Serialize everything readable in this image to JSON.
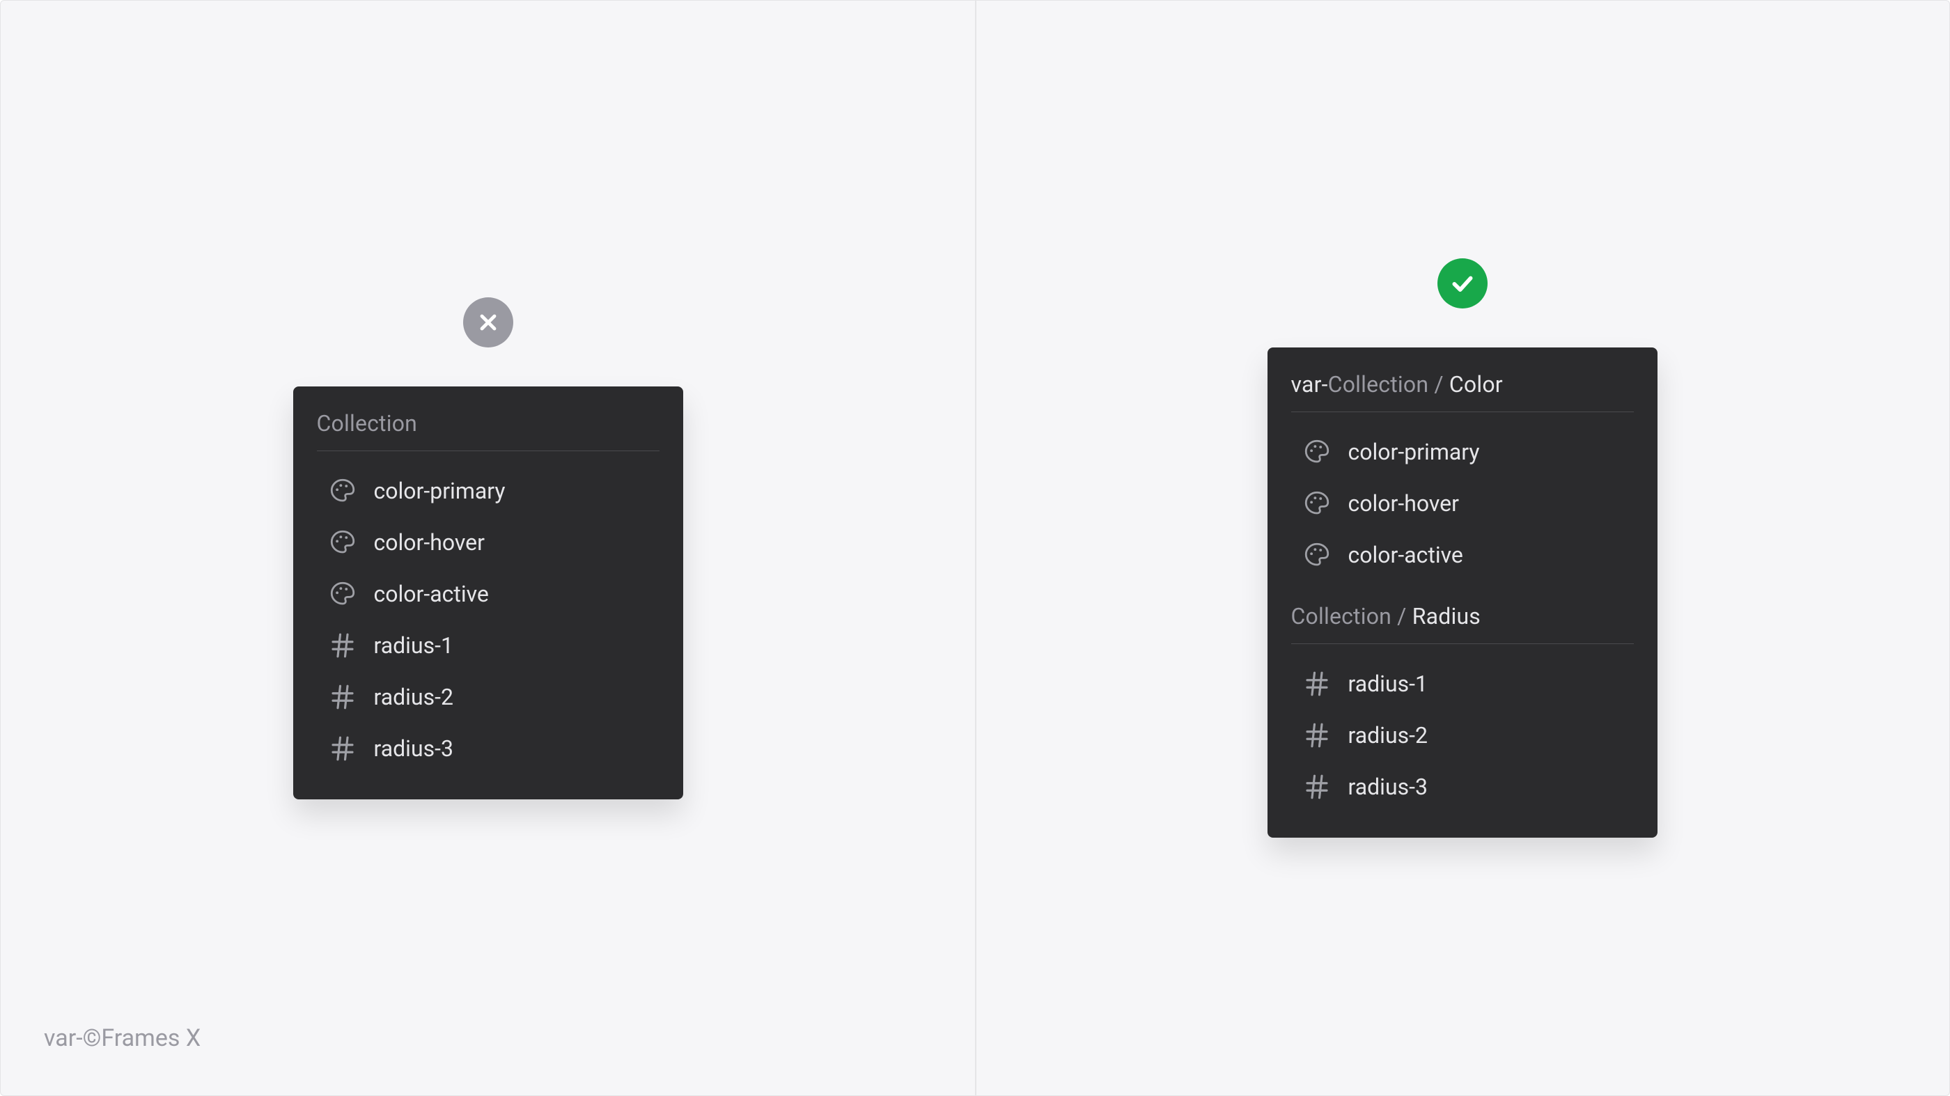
{
  "footer": "var-©Frames X",
  "left": {
    "title": "Collection",
    "items": [
      {
        "icon": "palette",
        "label": "color-primary"
      },
      {
        "icon": "palette",
        "label": "color-hover"
      },
      {
        "icon": "palette",
        "label": "color-active"
      },
      {
        "icon": "hash",
        "label": "radius-1"
      },
      {
        "icon": "hash",
        "label": "radius-2"
      },
      {
        "icon": "hash",
        "label": "radius-3"
      }
    ]
  },
  "right": {
    "sections": [
      {
        "title_prefix": "var-",
        "title_muted": "Collection / ",
        "title_accent": "Color",
        "items": [
          {
            "icon": "palette",
            "label": "color-primary"
          },
          {
            "icon": "palette",
            "label": "color-hover"
          },
          {
            "icon": "palette",
            "label": "color-active"
          }
        ]
      },
      {
        "title_prefix": "",
        "title_muted": "Collection / ",
        "title_accent": "Radius",
        "items": [
          {
            "icon": "hash",
            "label": "radius-1"
          },
          {
            "icon": "hash",
            "label": "radius-2"
          },
          {
            "icon": "hash",
            "label": "radius-3"
          }
        ]
      }
    ]
  }
}
